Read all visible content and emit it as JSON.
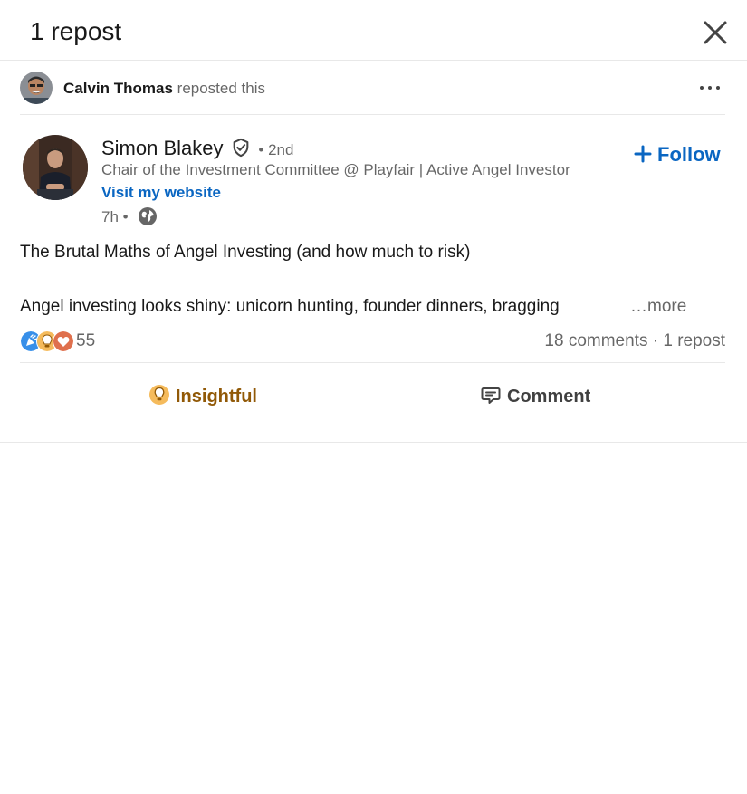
{
  "header": {
    "title": "1 repost"
  },
  "repost": {
    "reposter_name": "Calvin Thomas",
    "action_text": "reposted this"
  },
  "post": {
    "author": {
      "name": "Simon Blakey",
      "degree": "• 2nd",
      "headline": "Chair of the Investment Committee @ Playfair | Active Angel Investor",
      "website_label": "Visit my website",
      "time": "7h •"
    },
    "follow_label": "Follow",
    "title": "The Brutal Maths of Angel Investing (and how much to risk)",
    "body": "Angel investing looks shiny: unicorn hunting, founder dinners, bragging",
    "see_more": "…more",
    "reaction_count": "55",
    "comments": "18 comments",
    "separator": " · ",
    "reposts": "1 repost",
    "actions": {
      "insightful": "Insightful",
      "comment": "Comment"
    }
  },
  "icons": {
    "close": "close-icon",
    "more": "ellipsis-icon",
    "verified": "verified-shield-icon",
    "globe": "globe-icon",
    "follow": "plus-icon",
    "reactions": [
      "celebrate-icon",
      "insightful-icon",
      "love-icon"
    ],
    "insightful": "lightbulb-icon",
    "comment": "comment-icon"
  },
  "colors": {
    "link": "#0a66c2",
    "insightful": "#915907",
    "divider": "#e8e8e8"
  }
}
